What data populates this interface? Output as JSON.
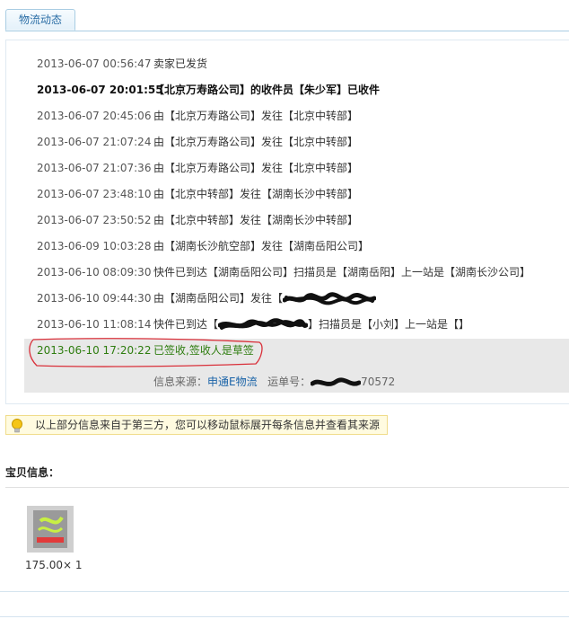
{
  "tab": {
    "label": "物流动态"
  },
  "events": [
    {
      "time": "2013-06-07 00:56:47",
      "desc": "卖家已发货"
    },
    {
      "time": "2013-06-07 20:01:55",
      "desc": "【北京万寿路公司】的收件员【朱少军】已收件"
    },
    {
      "time": "2013-06-07 20:45:06",
      "desc": "由【北京万寿路公司】发往【北京中转部】"
    },
    {
      "time": "2013-06-07 21:07:24",
      "desc": "由【北京万寿路公司】发往【北京中转部】"
    },
    {
      "time": "2013-06-07 21:07:36",
      "desc": "由【北京万寿路公司】发往【北京中转部】"
    },
    {
      "time": "2013-06-07 23:48:10",
      "desc": "由【北京中转部】发往【湖南长沙中转部】"
    },
    {
      "time": "2013-06-07 23:50:52",
      "desc": "由【北京中转部】发往【湖南长沙中转部】"
    },
    {
      "time": "2013-06-09 10:03:28",
      "desc": "由【湖南长沙航空部】发往【湖南岳阳公司】"
    },
    {
      "time": "2013-06-10 08:09:30",
      "desc": "快件已到达【湖南岳阳公司】扫描员是【湖南岳阳】上一站是【湖南长沙公司】"
    },
    {
      "time": "2013-06-10 09:44:30",
      "desc_prefix": "由【湖南岳阳公司】发往【"
    },
    {
      "time": "2013-06-10 11:08:14",
      "desc_prefix": "快件已到达【",
      "desc_suffix": "】扫描员是【小刘】上一站是【】"
    },
    {
      "time": "2013-06-10 17:20:22",
      "desc": "已签收,签收人是草签"
    }
  ],
  "source": {
    "label": "信息来源：",
    "provider": "申通E物流",
    "tracking_label": "运单号：",
    "tracking_visible": "70572"
  },
  "notice": {
    "text": "以上部分信息来自于第三方，您可以移动鼠标展开每条信息并查看其来源"
  },
  "goods": {
    "title": "宝贝信息：",
    "price": "175.00× 1"
  },
  "colors": {
    "link": "#1b64a8",
    "signed": "#2e7d0f",
    "mark": "#d9303a",
    "tab_border": "#a9cde3"
  }
}
